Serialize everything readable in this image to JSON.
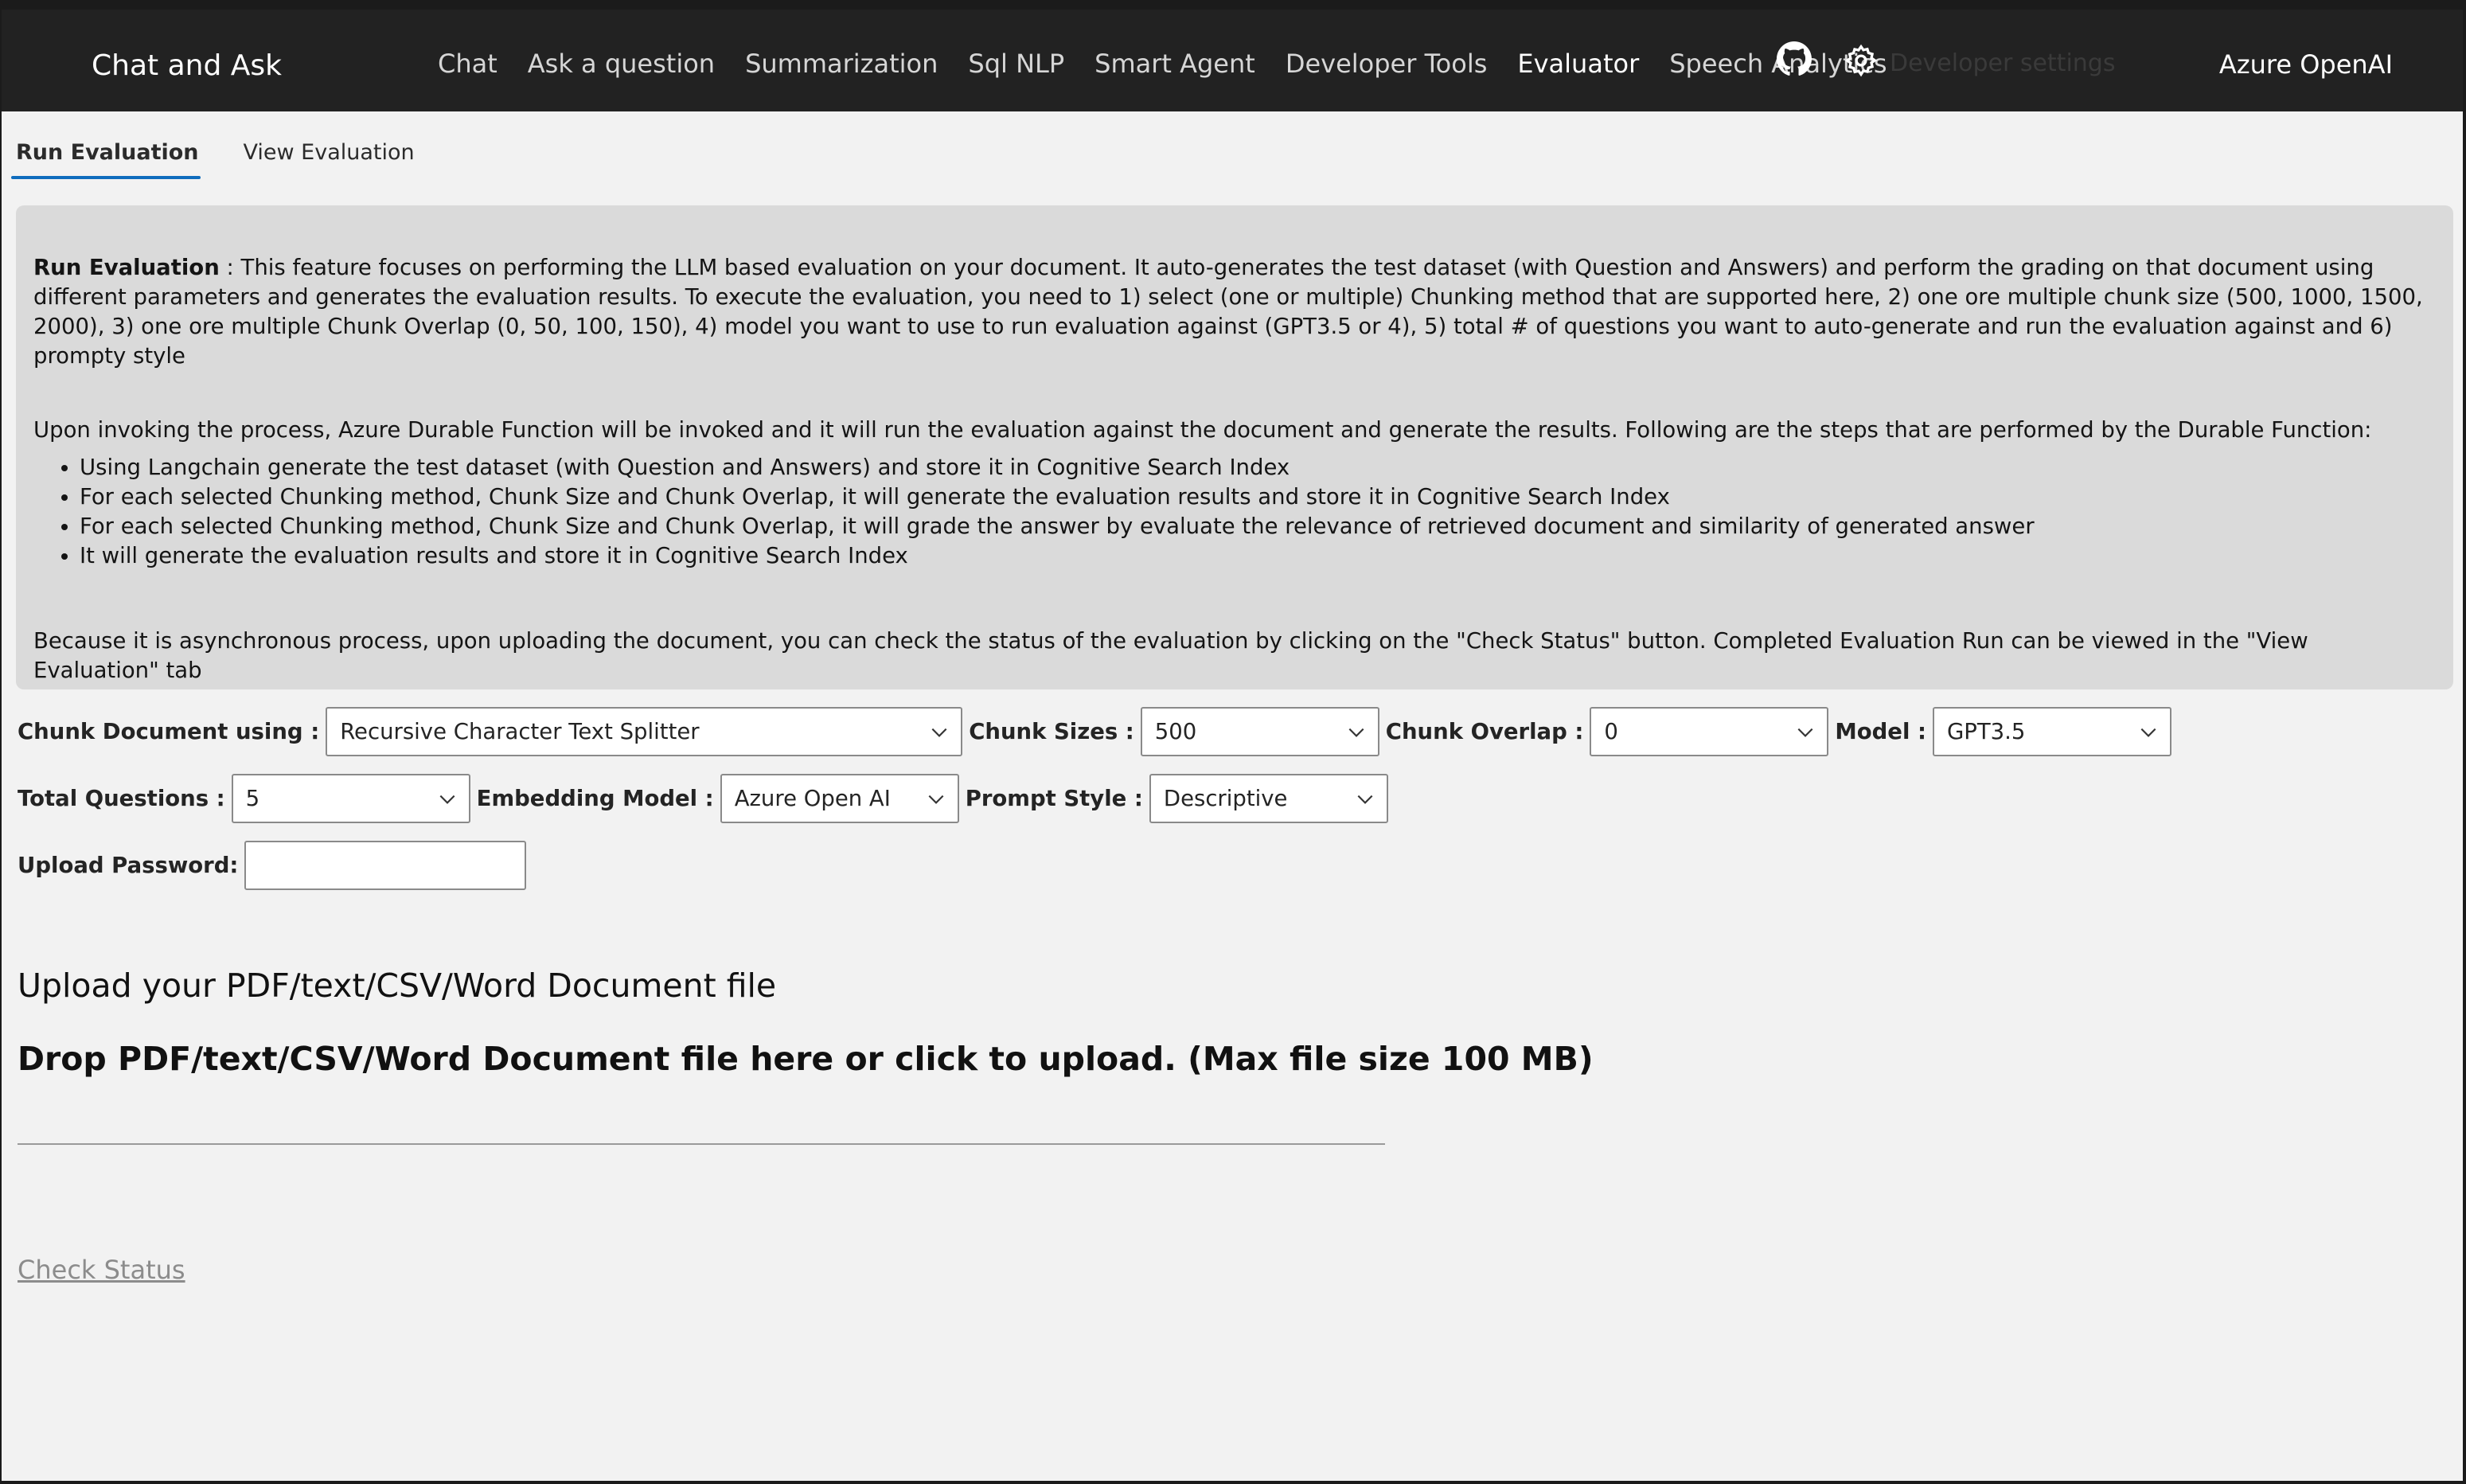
{
  "header": {
    "brand": "Chat and Ask",
    "nav": [
      "Chat",
      "Ask a question",
      "Summarization",
      "Sql NLP",
      "Smart Agent",
      "Developer Tools",
      "Evaluator",
      "Speech Analytics"
    ],
    "active_nav": "Evaluator",
    "github_icon": "github-icon",
    "settings_icon": "gear-icon",
    "dev_settings": "Developer settings",
    "right_title": "Azure OpenAI"
  },
  "tabs": [
    "Run Evaluation",
    "View Evaluation"
  ],
  "active_tab": "Run Evaluation",
  "info": {
    "title": "Run Evaluation",
    "intro": " : This feature focuses on performing the LLM based evaluation on your document. It auto-generates the test dataset (with Question and Answers) and perform the grading on that document using different parameters and generates the evaluation results. To execute the evaluation, you need to 1) select (one or multiple) Chunking method that are supported here, 2) one ore multiple chunk size (500, 1000, 1500, 2000), 3) one ore multiple Chunk Overlap (0, 50, 100, 150), 4) model you want to use to run evaluation against (GPT3.5 or 4), 5) total # of questions you want to auto-generate and run the evaluation against and 6) prompty style",
    "process": "Upon invoking the process, Azure Durable Function will be invoked and it will run the evaluation against the document and generate the results. Following are the steps that are performed by the Durable Function:",
    "steps": [
      "Using Langchain generate the test dataset (with Question and Answers) and store it in Cognitive Search Index",
      "For each selected Chunking method, Chunk Size and Chunk Overlap, it will generate the evaluation results and store it in Cognitive Search Index",
      "For each selected Chunking method, Chunk Size and Chunk Overlap, it will grade the answer by evaluate the relevance of retrieved document and similarity of generated answer",
      "It will generate the evaluation results and store it in Cognitive Search Index"
    ],
    "footer": "Because it is asynchronous process, upon uploading the document, you can check the status of the evaluation by clicking on the \"Check Status\" button. Completed Evaluation Run can be viewed in the \"View Evaluation\" tab"
  },
  "form": {
    "chunk_document_label": "Chunk Document using :",
    "chunk_document_value": "Recursive Character Text Splitter",
    "chunk_sizes_label": "Chunk Sizes :",
    "chunk_sizes_value": "500",
    "chunk_overlap_label": "Chunk Overlap :",
    "chunk_overlap_value": "0",
    "model_label": "Model :",
    "model_value": "GPT3.5",
    "total_questions_label": "Total Questions :",
    "total_questions_value": "5",
    "embedding_model_label": "Embedding Model :",
    "embedding_model_value": "Azure Open AI",
    "prompt_style_label": "Prompt Style :",
    "prompt_style_value": "Descriptive",
    "upload_password_label": "Upload Password:",
    "upload_password_value": ""
  },
  "upload": {
    "heading": "Upload your PDF/text/CSV/Word Document file",
    "drop_text": "Drop PDF/text/CSV/Word Document file here or click to upload. (Max file size 100 MB)"
  },
  "check_status": "Check Status",
  "colors": {
    "header_bg": "#222222",
    "panel_bg": "#dadada",
    "accent": "#0f6cbd"
  }
}
